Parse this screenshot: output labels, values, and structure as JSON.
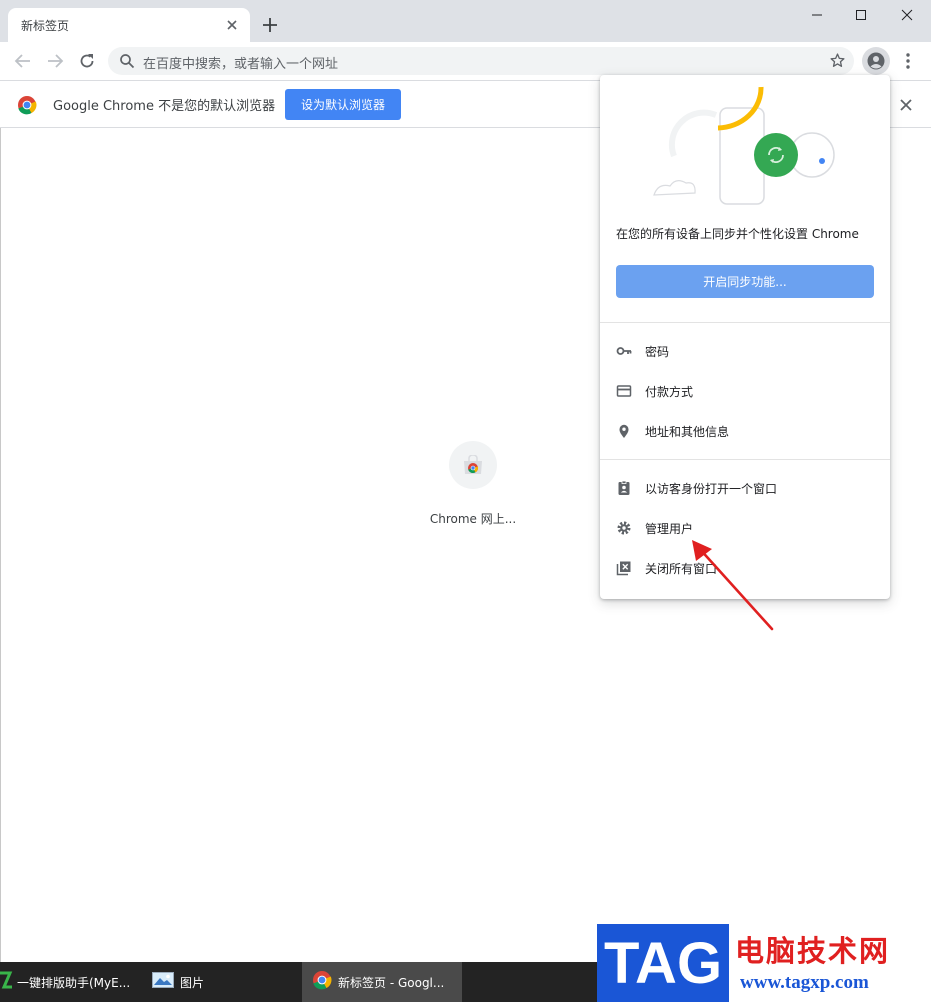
{
  "browser": {
    "tab_title": "新标签页",
    "omnibox_placeholder": "在百度中搜索，或者输入一个网址"
  },
  "infobar": {
    "message": "Google Chrome 不是您的默认浏览器",
    "button": "设为默认浏览器"
  },
  "content": {
    "tile_label": "Chrome 网上..."
  },
  "profile_menu": {
    "sync_message": "在您的所有设备上同步并个性化设置 Chrome",
    "sync_button": "开启同步功能...",
    "autofill_items": [
      {
        "label": "密码",
        "icon": "key-icon"
      },
      {
        "label": "付款方式",
        "icon": "credit-card-icon"
      },
      {
        "label": "地址和其他信息",
        "icon": "location-pin-icon"
      }
    ],
    "profile_items": [
      {
        "label": "以访客身份打开一个窗口",
        "icon": "guest-badge-icon"
      },
      {
        "label": "管理用户",
        "icon": "gear-icon"
      },
      {
        "label": "关闭所有窗口",
        "icon": "close-windows-icon"
      }
    ]
  },
  "taskbar": {
    "items": [
      {
        "label": "一键排版助手(MyE...",
        "icon": "myeditor-app-icon"
      },
      {
        "label": "图片",
        "icon": "photos-app-icon"
      },
      {
        "label": "新标签页 - Googl...",
        "icon": "chrome-icon",
        "active": true
      }
    ]
  },
  "watermark": {
    "logo": "TAG",
    "site_name": "电脑技术网",
    "url": "www.tagxp.com"
  },
  "colors": {
    "accent_blue": "#4285f4",
    "sync_button": "#6ba1f0",
    "annotation_arrow": "#e02020",
    "watermark_blue": "#1a56d6"
  }
}
